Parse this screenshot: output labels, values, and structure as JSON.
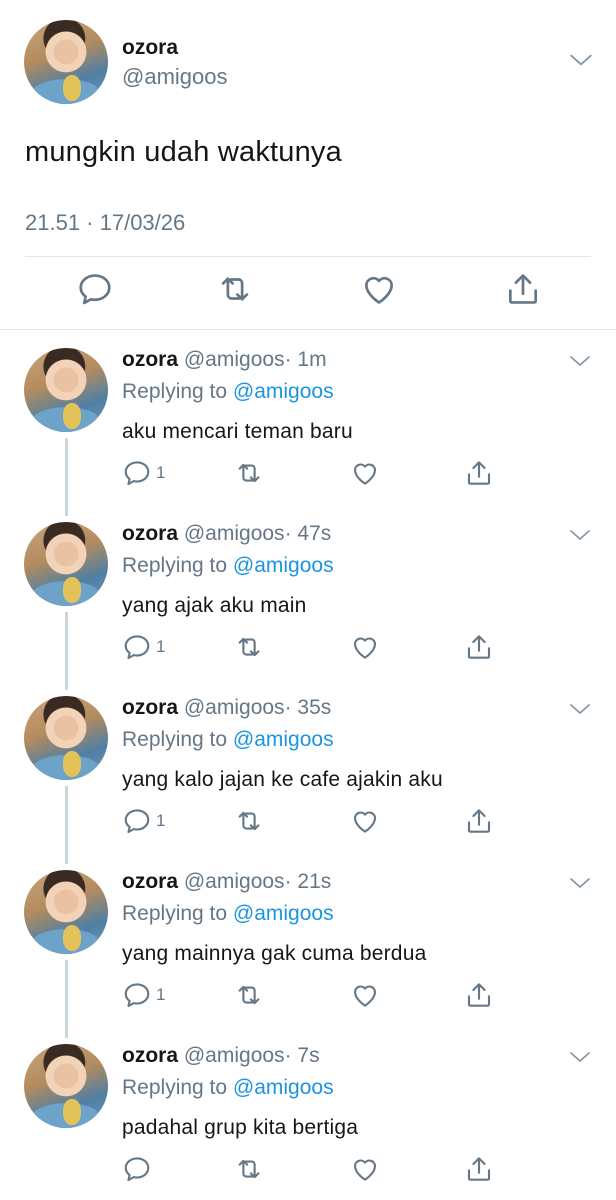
{
  "main_tweet": {
    "name": "ozora",
    "handle": "@amigoos",
    "text": "mungkin udah waktunya",
    "timestamp": "21.51 · 17/03/26",
    "actions": [
      "reply-icon",
      "retweet-icon",
      "like-icon",
      "share-icon"
    ]
  },
  "replies": [
    {
      "name": "ozora",
      "handle": "@amigoos",
      "time": "· 1m",
      "replying_prefix": "Replying to",
      "replying_to": "@amigoos",
      "text": "aku mencari teman baru",
      "reply_count": "1"
    },
    {
      "name": "ozora",
      "handle": "@amigoos",
      "time": "· 47s",
      "replying_prefix": "Replying to",
      "replying_to": "@amigoos",
      "text": "yang ajak aku main",
      "reply_count": "1"
    },
    {
      "name": "ozora",
      "handle": "@amigoos",
      "time": "· 35s",
      "replying_prefix": "Replying to",
      "replying_to": "@amigoos",
      "text": "yang kalo jajan ke cafe ajakin aku",
      "reply_count": "1"
    },
    {
      "name": "ozora",
      "handle": "@amigoos",
      "time": "· 21s",
      "replying_prefix": "Replying to",
      "replying_to": "@amigoos",
      "text": "yang mainnya gak cuma berdua",
      "reply_count": "1"
    },
    {
      "name": "ozora",
      "handle": "@amigoos",
      "time": "· 7s",
      "replying_prefix": "Replying to",
      "replying_to": "@amigoos",
      "text": "padahal grup kita bertiga",
      "reply_count": ""
    }
  ],
  "colors": {
    "text": "#14171a",
    "secondary": "#657786",
    "link": "#1b95e0",
    "divider": "#e1e8ed",
    "thread_line": "#ccd6dd"
  }
}
